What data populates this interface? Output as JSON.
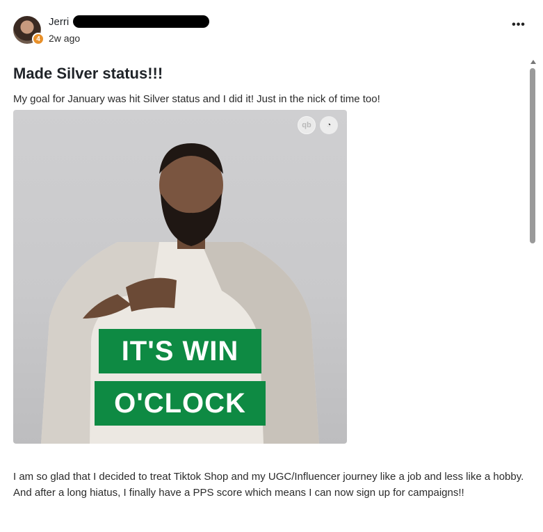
{
  "post": {
    "author": {
      "name": "Jerri",
      "level": "4",
      "time": "2w ago"
    },
    "more_label": "•••",
    "title": "Made Silver status!!!",
    "intro": "My goal for January was hit Silver status and I did it! Just in the nick of time too!",
    "gif": {
      "line1": "IT'S WIN",
      "line2": "O'CLOCK",
      "brand_logos": [
        "qb",
        "mailchimp-icon"
      ],
      "accent_color": "#0e8a43"
    },
    "body": "I am so glad that I decided to treat Tiktok Shop and my UGC/Influencer journey like a job and less like a hobby. And after a long hiatus, I finally have a PPS score which means I can now sign up for campaigns!!"
  },
  "icons": {
    "level_badge_color": "#e8902a"
  }
}
